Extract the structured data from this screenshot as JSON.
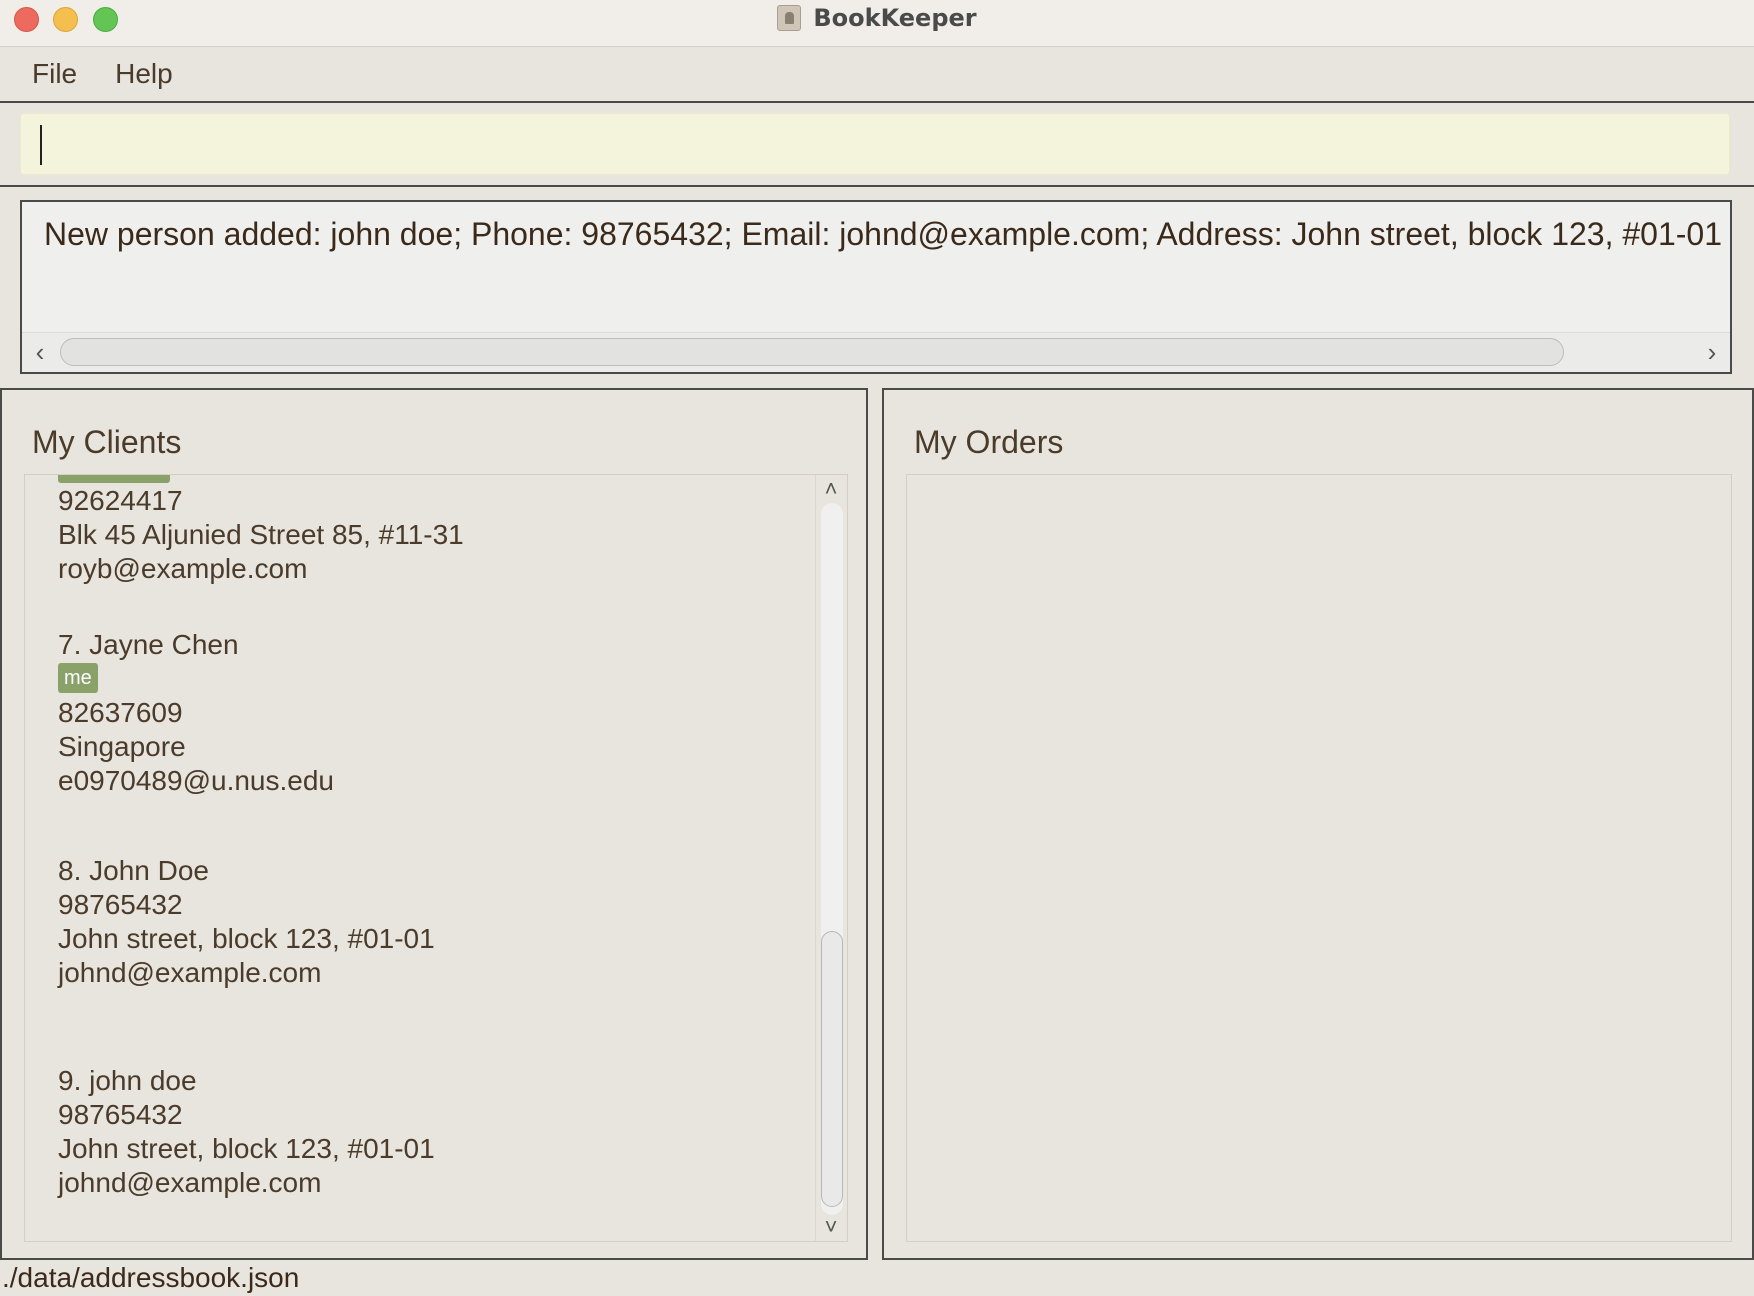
{
  "window": {
    "title": "BookKeeper",
    "controls": [
      "close",
      "minimize",
      "maximize"
    ]
  },
  "menu": {
    "file": "File",
    "help": "Help"
  },
  "command": {
    "value": "",
    "placeholder": ""
  },
  "result": {
    "text": "New person added: john doe; Phone: 98765432; Email: johnd@example.com; Address: John street, block 123, #01-01"
  },
  "clients": {
    "title": "My Clients",
    "partial": {
      "phone": "92624417",
      "address": "Blk 45 Aljunied Street 85, #11-31",
      "email": "royb@example.com"
    },
    "items": [
      {
        "name": "7.  Jayne Chen",
        "tag": "me",
        "phone": "82637609",
        "address": "Singapore",
        "email": "e0970489@u.nus.edu"
      },
      {
        "name": "8.  John Doe",
        "phone": "98765432",
        "address": "John street, block 123, #01-01",
        "email": "johnd@example.com"
      },
      {
        "name": "9.  john doe",
        "phone": "98765432",
        "address": "John street, block 123, #01-01",
        "email": "johnd@example.com"
      }
    ]
  },
  "orders": {
    "title": "My Orders"
  },
  "status": {
    "path": "./data/addressbook.json"
  },
  "colors": {
    "background": "#e8e4de",
    "text": "#4a3b2a",
    "command_bg": "#f4f3dc",
    "tag_bg": "#8aa16a",
    "close": "#ed6a5e",
    "minimize": "#f5bf4f",
    "maximize": "#62c554"
  },
  "icons": [
    "app-icon",
    "chevron-left-icon",
    "chevron-right-icon",
    "chevron-up-icon",
    "chevron-down-icon"
  ]
}
